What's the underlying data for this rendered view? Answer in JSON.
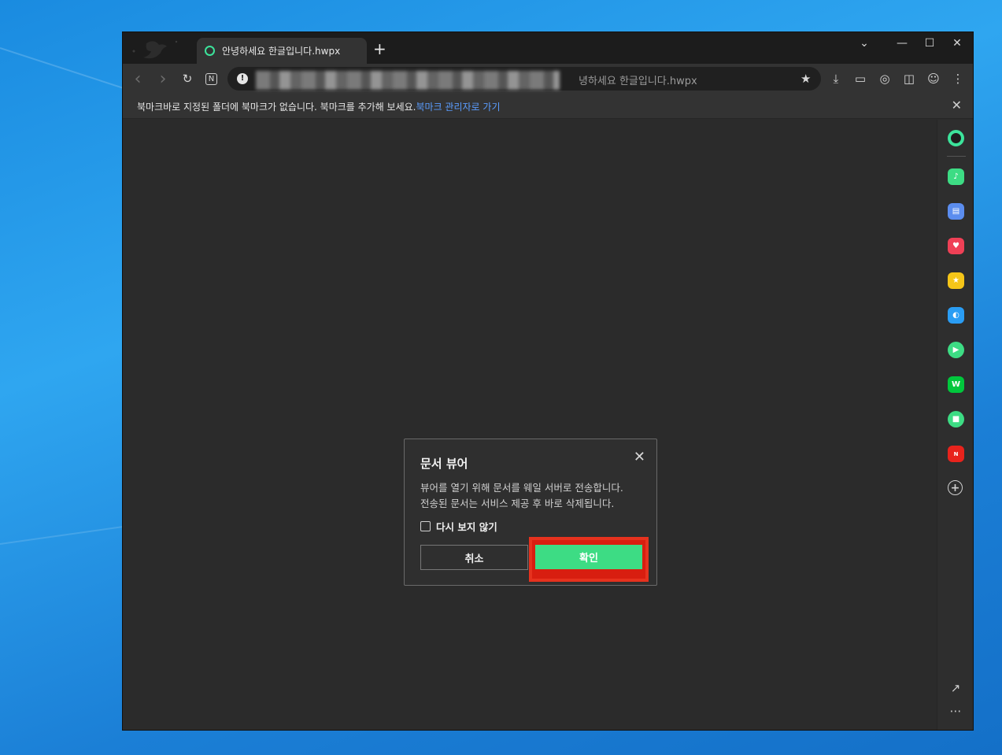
{
  "tab": {
    "title": "안녕하세요 한글입니다.hwpx",
    "new_tab_label": "+"
  },
  "window_controls": {
    "dropdown": "⌄",
    "minimize": "—",
    "maximize": "☐",
    "close": "✕"
  },
  "toolbar": {
    "back": "‹",
    "forward": "›",
    "reload": "↻",
    "n_icon": "N",
    "info": "!",
    "url_visible_text": "녕하세요 한글입니다.hwpx",
    "url_obscured": true,
    "bookmark_star": "★",
    "download": "⤓",
    "capture": "▭",
    "screenshot": "◎",
    "split": "◫",
    "profile": "☺",
    "menu": "⋮"
  },
  "bookmark_bar": {
    "message": "북마크바로 지정된 폴더에 북마크가 없습니다. 북마크를 추가해 보세요.",
    "link": "북마크 관리자로 가기",
    "close": "✕"
  },
  "dialog": {
    "title": "문서 뷰어",
    "close": "✕",
    "body_line1": "뷰어를 열기 위해 문서를 웨일 서버로 전송합니다.",
    "body_line2": "전송된 문서는 서비스 제공 후 바로 삭제됩니다.",
    "checkbox_label": "다시 보지 않기",
    "cancel_label": "취소",
    "ok_label": "확인"
  },
  "sidebar": {
    "items": [
      {
        "name": "whale-space-icon",
        "color": "#3ce39b",
        "glyph": "●"
      },
      {
        "name": "bell-icon",
        "color": "#3ddc84",
        "glyph": "♪"
      },
      {
        "name": "briefcase-icon",
        "color": "#5b8def",
        "glyph": "▤"
      },
      {
        "name": "pocket-icon",
        "color": "#ef4056",
        "glyph": "♥"
      },
      {
        "name": "star-icon",
        "color": "#f5c518",
        "glyph": "★"
      },
      {
        "name": "papago-icon",
        "color": "#2a9df4",
        "glyph": "◐"
      },
      {
        "name": "play-icon",
        "color": "#3ddc84",
        "glyph": "▶"
      },
      {
        "name": "webtoon-icon",
        "color": "#00c73c",
        "glyph": "W"
      },
      {
        "name": "memo-icon",
        "color": "#3ddc84",
        "glyph": "■"
      },
      {
        "name": "now-icon",
        "color": "#e8231c",
        "glyph": "N"
      }
    ],
    "add": "+",
    "open_external": "↗",
    "more": "⋯"
  }
}
